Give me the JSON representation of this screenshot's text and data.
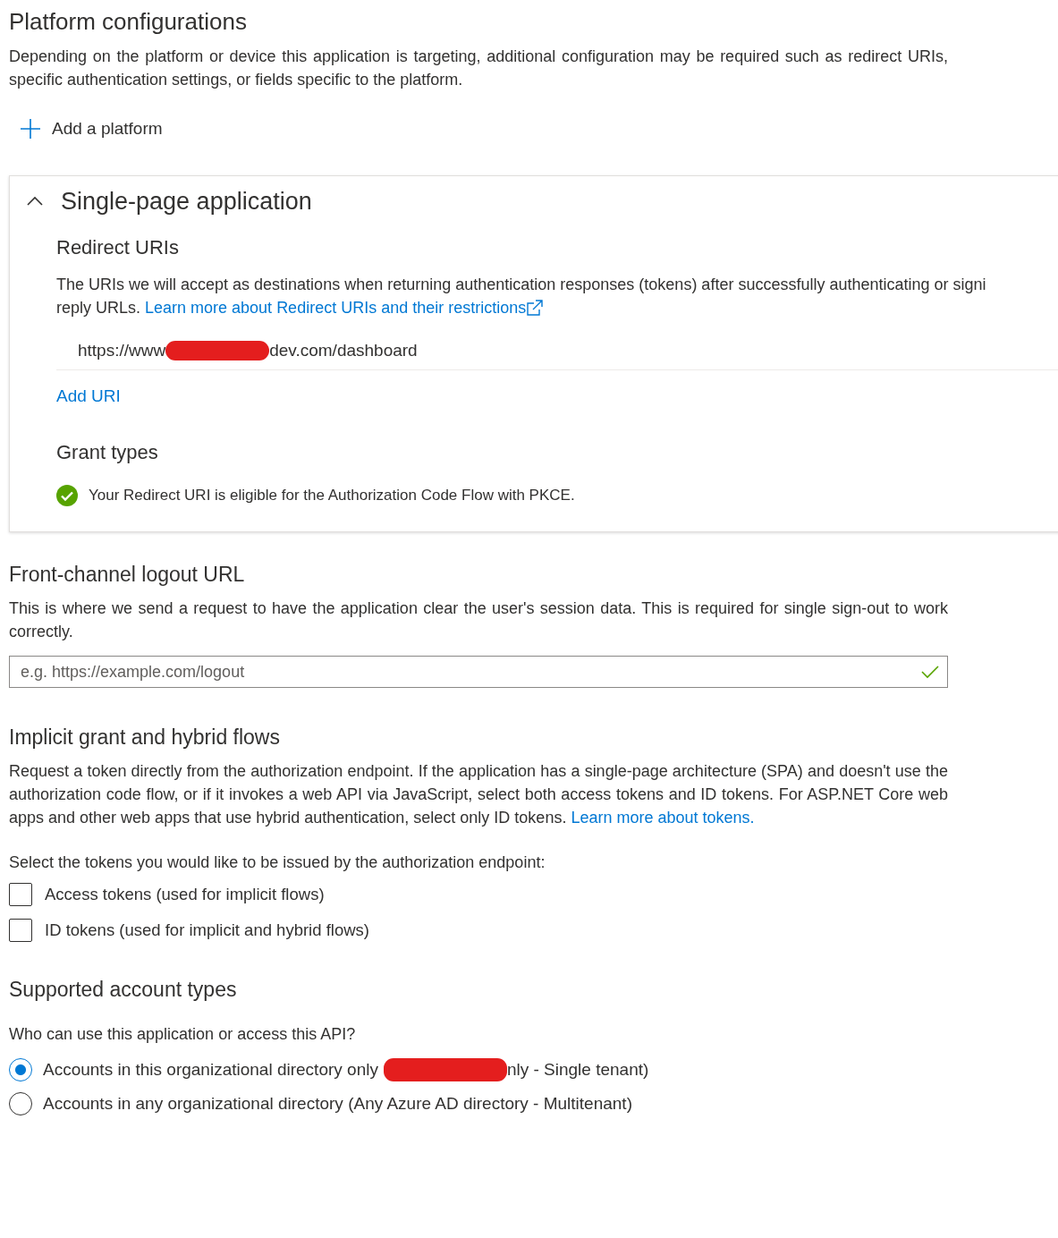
{
  "platforms": {
    "title": "Platform configurations",
    "description": "Depending on the platform or device this application is targeting, additional configuration may be required such as redirect URIs, specific authentication settings, or fields specific to the platform.",
    "add_button": "Add a platform"
  },
  "spa_card": {
    "title": "Single-page application",
    "expanded": true,
    "redirect_heading": "Redirect URIs",
    "description_lines": [
      "The URIs we will accept as destinations when returning authentication responses (tokens) after successfully authenticating or signi",
      "reply URLs."
    ],
    "description_link": "Learn more about Redirect URIs and their restrictions",
    "uri": {
      "before_redaction": "https://www",
      "after_redaction": "dev.com/dashboard"
    },
    "add_uri": "Add URI",
    "grant_heading": "Grant types",
    "grant_status": "Your Redirect URI is eligible for the Authorization Code Flow with PKCE."
  },
  "logout": {
    "title": "Front-channel logout URL",
    "description": "This is where we send a request to have the application clear the user's session data. This is required for single sign-out to work correctly.",
    "placeholder": "e.g. https://example.com/logout",
    "valid": true
  },
  "implicit": {
    "title": "Implicit grant and hybrid flows",
    "description": "Request a token directly from the authorization endpoint. If the application has a single-page architecture (SPA) and doesn't use the authorization code flow, or if it invokes a web API via JavaScript, select both access tokens and ID tokens. For ASP.NET Core web apps and other web apps that use hybrid authentication, select only ID tokens.",
    "link": "Learn more about tokens.",
    "prompt": "Select the tokens you would like to be issued by the authorization endpoint:",
    "options": [
      {
        "label": "Access tokens (used for implicit flows)",
        "checked": false
      },
      {
        "label": "ID tokens (used for implicit and hybrid flows)",
        "checked": false
      }
    ]
  },
  "accounts": {
    "title": "Supported account types",
    "prompt": "Who can use this application or access this API?",
    "options": [
      {
        "label": "Accounts in this organizational directory only",
        "after_redaction": "nly - Single tenant)",
        "selected": true
      },
      {
        "label": "Accounts in any organizational directory (Any Azure AD directory - Multitenant)",
        "selected": false
      }
    ]
  }
}
